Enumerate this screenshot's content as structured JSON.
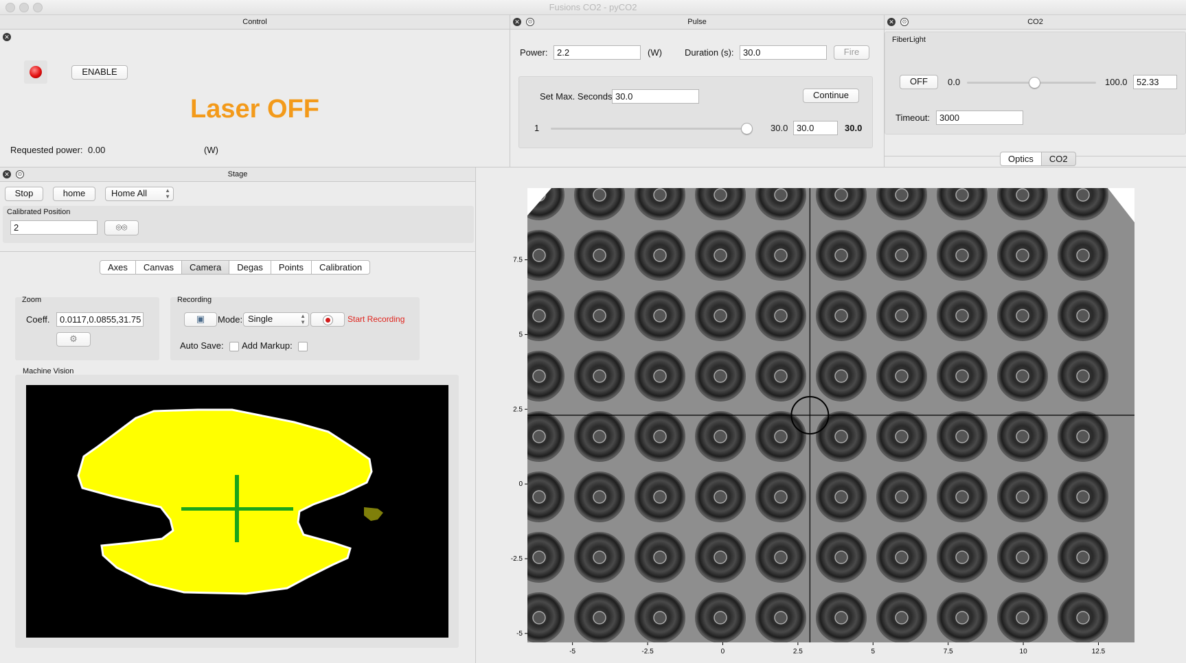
{
  "window": {
    "title": "Fusions CO2 - pyCO2"
  },
  "control": {
    "header": "Control",
    "enable_label": "ENABLE",
    "laser_status": "Laser OFF",
    "laser_status_color": "#f39a1a",
    "requested_power_label": "Requested power:",
    "requested_power_value": "0.00",
    "requested_power_unit": "(W)"
  },
  "pulse": {
    "header": "Pulse",
    "power_label": "Power:",
    "power_value": "2.2",
    "power_unit": "(W)",
    "duration_label": "Duration (s):",
    "duration_value": "30.0",
    "fire_label": "Fire",
    "max_seconds_label": "Set Max. Seconds:",
    "max_seconds_value": "30.0",
    "continue_label": "Continue",
    "slider_min": "1",
    "slider_max": "30.0",
    "slider_field": "30.0",
    "slider_value": "30.0",
    "slider_fraction": 1.0
  },
  "co2": {
    "header": "CO2",
    "fiberlight_label": "FiberLight",
    "off_label": "OFF",
    "slider_min": "0.0",
    "slider_max": "100.0",
    "slider_value": "52.33",
    "slider_fraction": 0.5233,
    "timeout_label": "Timeout:",
    "timeout_value": "3000",
    "tabs": [
      "Optics",
      "CO2"
    ]
  },
  "stage": {
    "header": "Stage",
    "stop_label": "Stop",
    "home_label": "home",
    "home_select": "Home All",
    "calibrated_position_label": "Calibrated Position",
    "calibrated_position_value": "2",
    "tabs": [
      "Axes",
      "Canvas",
      "Camera",
      "Degas",
      "Points",
      "Calibration"
    ],
    "active_tab": "Camera",
    "zoom": {
      "label": "Zoom",
      "coeff_label": "Coeff.",
      "coeff_value": "0.0117,0.0855,31.75"
    },
    "recording": {
      "label": "Recording",
      "mode_label": "Mode:",
      "mode_value": "Single",
      "start_label": "Start Recording",
      "start_color": "#e0231c",
      "autosave_label": "Auto Save:",
      "markup_label": "Add Markup:"
    },
    "machine_vision_label": "Machine Vision"
  },
  "camera_plot": {
    "x_ticks": [
      "-5",
      "-2.5",
      "0",
      "2.5",
      "5",
      "7.5",
      "10",
      "12.5"
    ],
    "y_ticks": [
      "7.5",
      "5",
      "2.5",
      "0",
      "-2.5",
      "-5"
    ],
    "crosshair": {
      "x": 2.9,
      "y": 2.3
    }
  }
}
